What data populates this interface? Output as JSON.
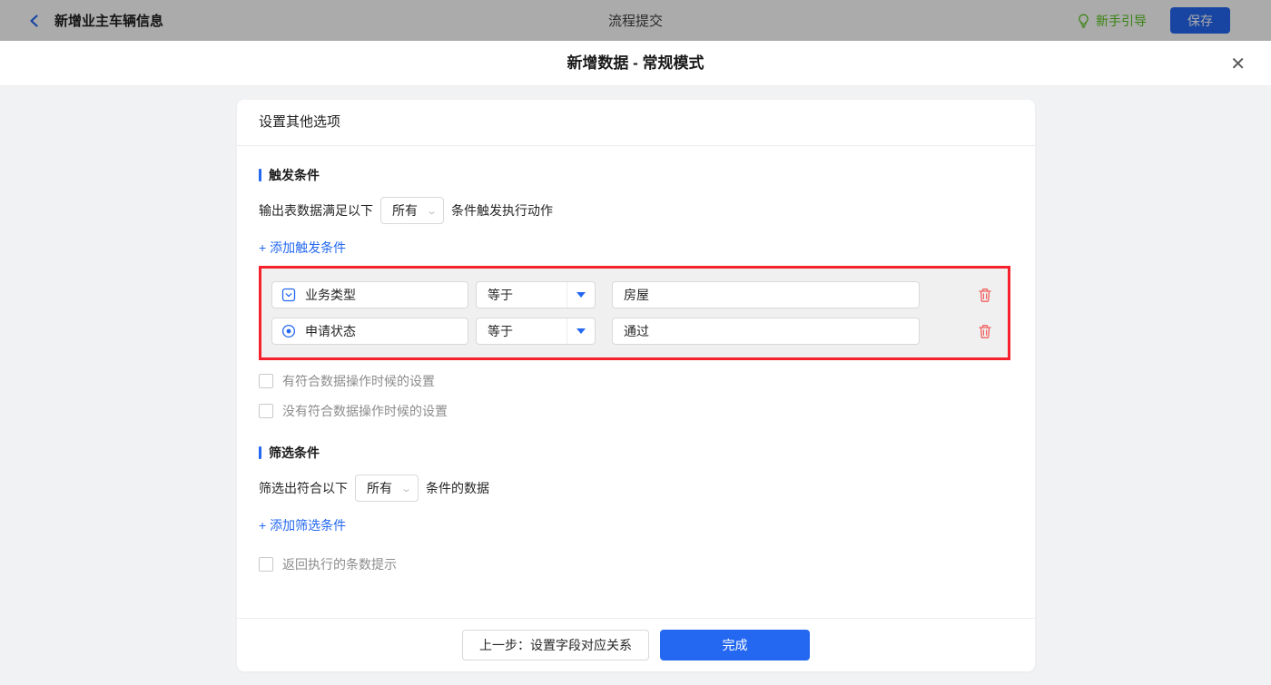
{
  "topbar": {
    "back_title": "新增业主车辆信息",
    "center_title": "流程提交",
    "guide_label": "新手引导",
    "save_label": "保存"
  },
  "modal": {
    "title": "新增数据 - 常规模式",
    "close_glyph": "✕"
  },
  "card": {
    "header_title": "设置其他选项"
  },
  "trigger": {
    "title": "触发条件",
    "prefix": "输出表数据满足以下",
    "select_value": "所有",
    "select_caret": "⌄",
    "suffix": "条件触发执行动作",
    "add_link": "+ 添加触发条件",
    "conditions": [
      {
        "field": "业务类型",
        "field_icon": "select-field-icon",
        "operator": "等于",
        "value": "房屋"
      },
      {
        "field": "申请状态",
        "field_icon": "radio-field-icon",
        "operator": "等于",
        "value": "通过"
      }
    ],
    "checkboxes": [
      "有符合数据操作时候的设置",
      "没有符合数据操作时候的设置"
    ]
  },
  "filter": {
    "title": "筛选条件",
    "prefix": "筛选出符合以下",
    "select_value": "所有",
    "select_caret": "⌄",
    "suffix": "条件的数据",
    "add_link": "+ 添加筛选条件",
    "checkbox": "返回执行的条数提示"
  },
  "footer": {
    "prev_label": "上一步：设置字段对应关系",
    "done_label": "完成"
  },
  "colors": {
    "accent_blue": "#2468f2",
    "annotation_red": "#f5222d",
    "guide_green": "#52c41a",
    "trash_red": "#f25d5d",
    "page_background": "#f1f2f4",
    "annotation_fill": "#f0f0f0"
  }
}
